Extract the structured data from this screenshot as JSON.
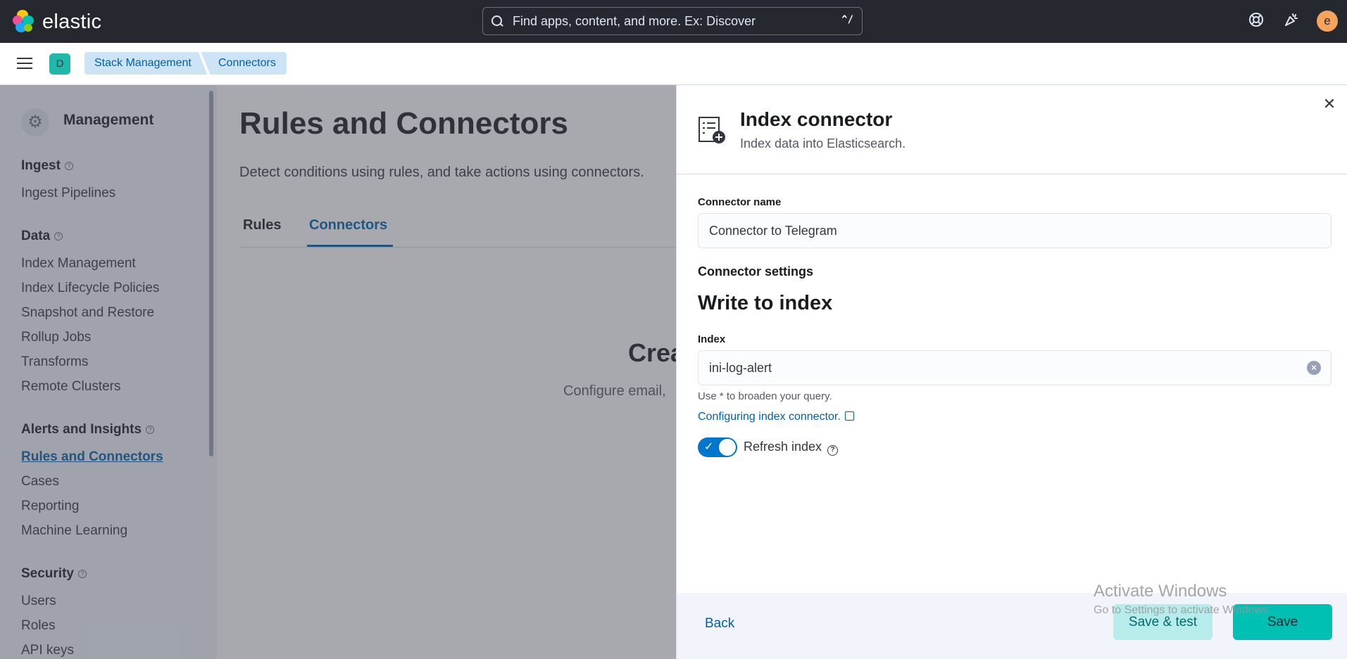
{
  "header": {
    "brand": "elastic",
    "search_placeholder": "Find apps, content, and more. Ex: Discover",
    "search_shortcut": "^/",
    "user_initial": "e"
  },
  "subbar": {
    "space_initial": "D",
    "breadcrumbs": [
      "Stack Management",
      "Connectors"
    ]
  },
  "sidebar": {
    "title": "Management",
    "groups": [
      {
        "label": "Ingest",
        "items": [
          "Ingest Pipelines"
        ]
      },
      {
        "label": "Data",
        "items": [
          "Index Management",
          "Index Lifecycle Policies",
          "Snapshot and Restore",
          "Rollup Jobs",
          "Transforms",
          "Remote Clusters"
        ]
      },
      {
        "label": "Alerts and Insights",
        "items": [
          "Rules and Connectors",
          "Cases",
          "Reporting",
          "Machine Learning"
        ]
      },
      {
        "label": "Security",
        "items": [
          "Users",
          "Roles",
          "API keys"
        ]
      }
    ],
    "active_item": "Rules and Connectors"
  },
  "main": {
    "title": "Rules and Connectors",
    "description": "Detect conditions using rules, and take actions using connectors.",
    "tabs": [
      "Rules",
      "Connectors"
    ],
    "active_tab": "Connectors",
    "empty_title": "Crea",
    "empty_desc": "Configure email,"
  },
  "flyout": {
    "title": "Index connector",
    "subtitle": "Index data into Elasticsearch.",
    "connector_name_label": "Connector name",
    "connector_name_value": "Connector to Telegram",
    "settings_label": "Connector settings",
    "section_title": "Write to index",
    "index_label": "Index",
    "index_value": "ini-log-alert",
    "index_help": "Use * to broaden your query.",
    "docs_link": "Configuring index connector.",
    "refresh_label": "Refresh index",
    "refresh_enabled": true,
    "back_label": "Back",
    "save_test_label": "Save & test",
    "save_label": "Save"
  },
  "watermark": {
    "line1": "Activate Windows",
    "line2": "Go to Settings to activate Windows."
  }
}
